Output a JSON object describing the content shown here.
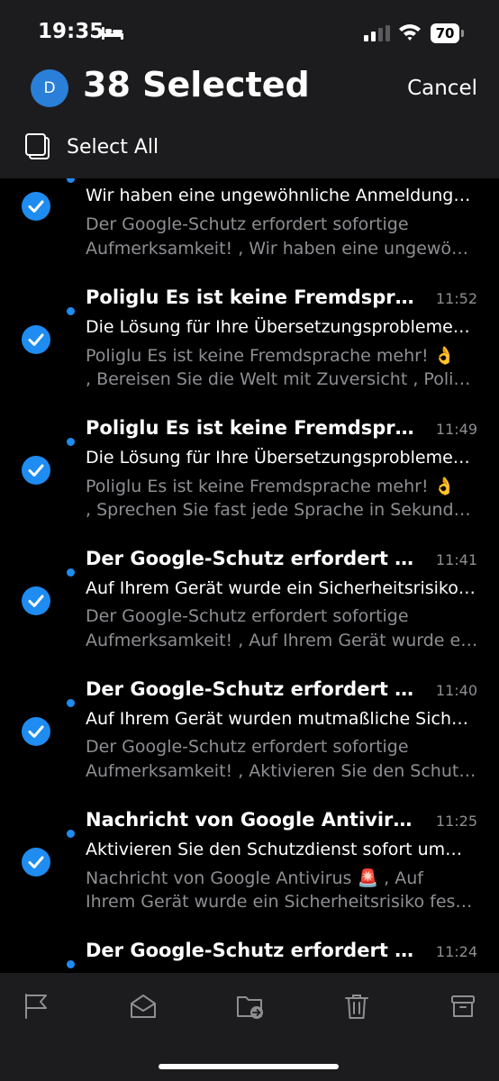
{
  "status_bar": {
    "time": "19:35",
    "battery": "70"
  },
  "header": {
    "avatar_initial": "D",
    "title": "38 Selected",
    "cancel_label": "Cancel",
    "select_all_label": "Select All"
  },
  "emails": [
    {
      "sender": "",
      "time": "",
      "subject": "Wir haben eine ungewöhnliche Anmeldung…",
      "preview1": "Der Google-Schutz erfordert sofortige",
      "preview2": "Aufmerksamkeit! , Wir haben eine ungewö…"
    },
    {
      "sender": "Poliglu Es ist keine Fremdsprach…",
      "time": "11:52",
      "subject": "Die Lösung für Ihre Übersetzungsprobleme…",
      "preview1": "Poliglu Es ist keine Fremdsprache mehr! 👌",
      "preview2": ", Bereisen Sie die Welt mit Zuversicht , Poligl…"
    },
    {
      "sender": "Poliglu Es ist keine Fremdsprach…",
      "time": "11:49",
      "subject": "Die Lösung für Ihre Übersetzungsprobleme…",
      "preview1": "Poliglu Es ist keine Fremdsprache mehr! 👌",
      "preview2": ", Sprechen Sie fast jede Sprache in Sekunde…"
    },
    {
      "sender": "Der Google-Schutz erfordert sofor…",
      "time": "11:41",
      "subject": "Auf Ihrem Gerät wurde ein Sicherheitsrisiko…",
      "preview1": "Der Google-Schutz erfordert sofortige",
      "preview2": "Aufmerksamkeit! , Auf Ihrem Gerät wurde e…"
    },
    {
      "sender": "Der Google-Schutz erfordert sof…",
      "time": "11:40",
      "subject": "Auf Ihrem Gerät wurden mutmaßliche Sich…",
      "preview1": "Der Google-Schutz erfordert sofortige",
      "preview2": "Aufmerksamkeit! , Aktivieren Sie den Schut…"
    },
    {
      "sender": "Nachricht von Google Antivirus 🚨",
      "time": "11:25",
      "subject": "Aktivieren Sie den Schutzdienst sofort um…",
      "preview1": "Nachricht von Google Antivirus 🚨 , Auf",
      "preview2": "Ihrem Gerät wurde ein Sicherheitsrisiko fes…"
    },
    {
      "sender": "Der Google-Schutz erfordert sof…",
      "time": "11:24",
      "subject": "",
      "preview1": "",
      "preview2": ""
    }
  ],
  "toolbar": {
    "icons": [
      "flag-icon",
      "envelope-open-icon",
      "folder-move-icon",
      "trash-icon",
      "archive-icon"
    ]
  },
  "colors": {
    "accent": "#1e8cf0",
    "header_bg": "#1c1c1e",
    "list_bg": "#000000",
    "secondary_text": "#8e8e93"
  }
}
